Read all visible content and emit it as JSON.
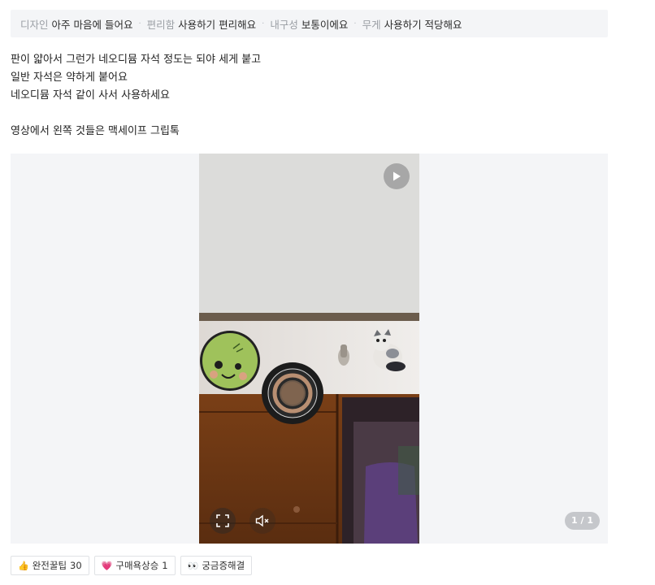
{
  "attributes": [
    {
      "key": "디자인",
      "value": "아주 마음에 들어요"
    },
    {
      "key": "편리함",
      "value": "사용하기 편리해요"
    },
    {
      "key": "내구성",
      "value": "보통이에요"
    },
    {
      "key": "무게",
      "value": "사용하기 적당해요"
    }
  ],
  "review": {
    "line1": "판이 얇아서 그런가 네오디뮴 자석 정도는 되야 세게 붙고",
    "line2": "일반 자석은 약하게 붙어요",
    "line3": "네오디뮴 자석 같이 사서 사용하세요",
    "line4": "영상에서 왼쪽 것들은 맥세이프 그립톡"
  },
  "media": {
    "counter": "1 / 1"
  },
  "reactions": [
    {
      "emoji": "👍",
      "label": "완전꿀팁",
      "count": "30"
    },
    {
      "emoji": "💗",
      "label": "구매욕상승",
      "count": "1"
    },
    {
      "emoji": "👀",
      "label": "궁금증해결",
      "count": ""
    }
  ],
  "icons": {
    "play": "play-icon",
    "fullscreen": "fullscreen-icon",
    "mute": "mute-icon"
  }
}
